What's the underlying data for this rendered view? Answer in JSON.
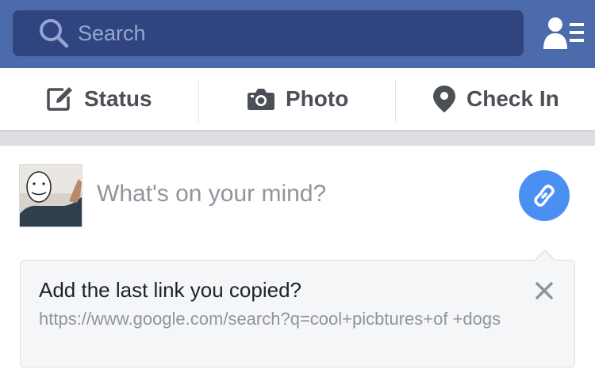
{
  "header": {
    "search_placeholder": "Search",
    "icons": {
      "search": "search-icon",
      "friends": "friend-requests-icon"
    },
    "colors": {
      "bar": "#4b6bad",
      "search_field": "#30457f"
    }
  },
  "actions": [
    {
      "label": "Status",
      "icon": "compose-icon"
    },
    {
      "label": "Photo",
      "icon": "camera-icon"
    },
    {
      "label": "Check In",
      "icon": "location-pin-icon"
    }
  ],
  "composer": {
    "prompt": "What's on your mind?",
    "link_button_icon": "link-icon",
    "accent": "#4a90f2"
  },
  "link_suggestion": {
    "title": "Add the last link you copied?",
    "url": "https://www.google.com/search?q=cool+picbtures+of +dogs",
    "close_icon": "close-icon"
  }
}
